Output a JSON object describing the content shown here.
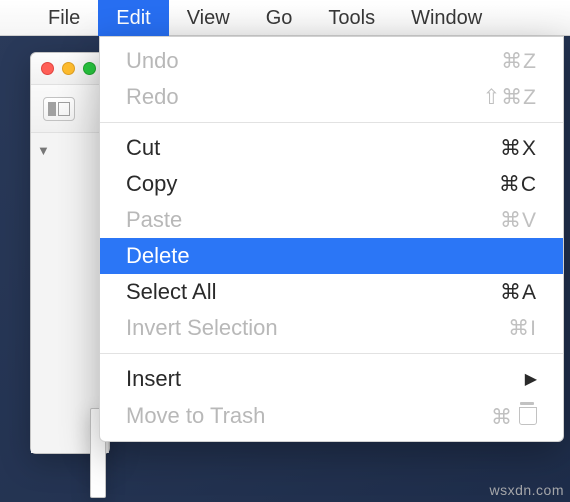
{
  "menubar": {
    "items": [
      {
        "label": "File"
      },
      {
        "label": "Edit"
      },
      {
        "label": "View"
      },
      {
        "label": "Go"
      },
      {
        "label": "Tools"
      },
      {
        "label": "Window"
      }
    ],
    "active_index": 1
  },
  "dropdown": {
    "groups": [
      [
        {
          "label": "Undo",
          "shortcut": "⌘Z",
          "disabled": true
        },
        {
          "label": "Redo",
          "shortcut": "⇧⌘Z",
          "disabled": true
        }
      ],
      [
        {
          "label": "Cut",
          "shortcut": "⌘X",
          "disabled": false
        },
        {
          "label": "Copy",
          "shortcut": "⌘C",
          "disabled": false
        },
        {
          "label": "Paste",
          "shortcut": "⌘V",
          "disabled": true
        },
        {
          "label": "Delete",
          "shortcut": "",
          "disabled": false,
          "highlighted": true
        },
        {
          "label": "Select All",
          "shortcut": "⌘A",
          "disabled": false
        },
        {
          "label": "Invert Selection",
          "shortcut": "⌘I",
          "disabled": true
        }
      ],
      [
        {
          "label": "Insert",
          "submenu": true,
          "disabled": false
        },
        {
          "label": "Move to Trash",
          "shortcut": "⌘",
          "trash_icon": true,
          "disabled": true
        }
      ]
    ]
  },
  "watermark": "wsxdn.com"
}
